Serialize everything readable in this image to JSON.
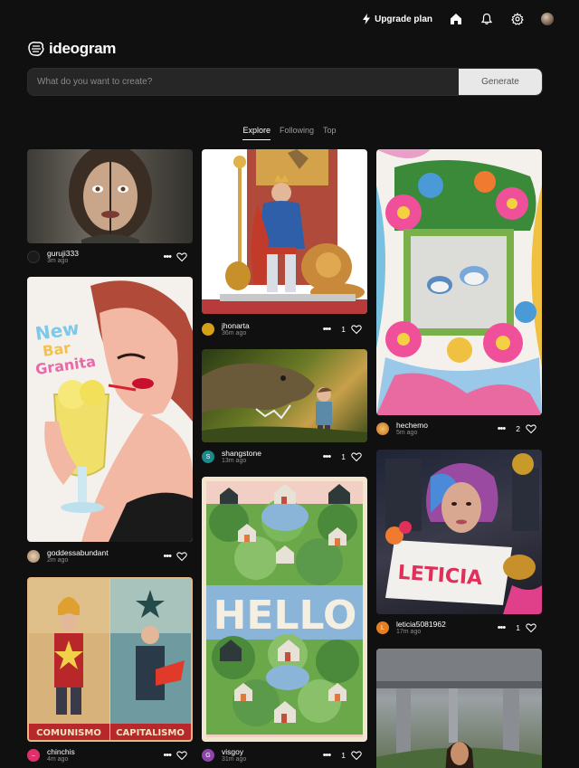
{
  "nav": {
    "upgrade_label": "Upgrade plan"
  },
  "logo": {
    "text": "ideogram"
  },
  "search": {
    "placeholder": "What do you want to create?",
    "button_label": "Generate"
  },
  "tabs": [
    "Explore",
    "Following",
    "Top"
  ],
  "cards": [
    {
      "user": "guruji333",
      "time": "3m ago",
      "likes": "",
      "avatar_color": "#1a1a1a"
    },
    {
      "user": "goddessabundant",
      "time": "2m ago",
      "likes": "",
      "avatar_color": "#c9a27d"
    },
    {
      "user": "chinchis",
      "time": "4m ago",
      "likes": "",
      "avatar_color": "#e0306a"
    },
    {
      "user": "jhonarta",
      "time": "36m ago",
      "likes": "1",
      "avatar_color": "#d4a017"
    },
    {
      "user": "shangstone",
      "time": "13m ago",
      "likes": "1",
      "avatar_color": "#1b8a8a",
      "initial": "S"
    },
    {
      "user": "visgoy",
      "time": "31m ago",
      "likes": "1",
      "avatar_color": "#8e44ad",
      "initial": "G"
    },
    {
      "user": "hechemo",
      "time": "5m ago",
      "likes": "2",
      "avatar_color": "#e67e22"
    },
    {
      "user": "leticia5081962",
      "time": "17m ago",
      "likes": "1",
      "avatar_color": "#e67e22",
      "initial": "L"
    }
  ],
  "poster_text": {
    "hello": "HELLO",
    "comunismo": "COMUNISMO",
    "capitalismo": "CAPITALISMO",
    "leticia": "LETICIA",
    "new_bar": "New",
    "bar": "Bar",
    "granita": "Granita"
  }
}
